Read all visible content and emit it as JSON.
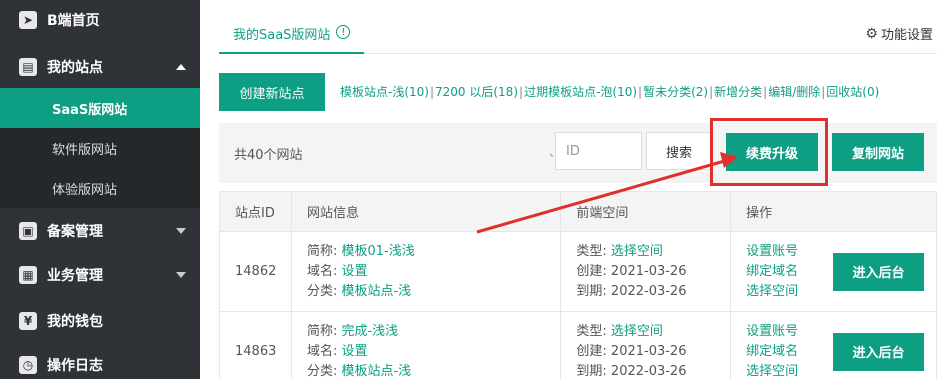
{
  "sidebar": {
    "items": [
      {
        "label": "B端首页",
        "icon": "paper-plane-icon",
        "glyph": "➤"
      },
      {
        "label": "我的站点",
        "icon": "document-icon",
        "glyph": "▤"
      }
    ],
    "subitems": [
      {
        "label": "SaaS版网站"
      },
      {
        "label": "软件版网站"
      },
      {
        "label": "体验版网站"
      }
    ],
    "more": [
      {
        "label": "备案管理",
        "icon": "gift-icon",
        "glyph": "▣"
      },
      {
        "label": "业务管理",
        "icon": "grid-icon",
        "glyph": "▦"
      },
      {
        "label": "我的钱包",
        "icon": "yen-icon",
        "glyph": "¥"
      },
      {
        "label": "操作日志",
        "icon": "clock-icon",
        "glyph": "◷"
      }
    ]
  },
  "tabs": {
    "active": "我的SaaS版网站",
    "info_glyph": "!",
    "settings_label": "功能设置",
    "settings_glyph": "⚙"
  },
  "toolbar": {
    "create_label": "创建新站点",
    "categories": [
      "模板站点-浅(10)",
      "7200 以后(18)",
      "过期模板站点-泡(10)",
      "暂未分类(2)",
      "新增分类",
      "编辑/删除",
      "回收站(0)"
    ],
    "separator": "|"
  },
  "filter": {
    "count_label": "共40个网站",
    "search_placeholder": "ID",
    "search_prefix": "、",
    "search_label": "搜索",
    "renew_label": "续费升级",
    "copy_label": "复制网站"
  },
  "table": {
    "headers": [
      "站点ID",
      "网站信息",
      "前端空间",
      "操作"
    ],
    "rows": [
      {
        "id": "14862",
        "info": [
          {
            "k": "简称: ",
            "v": "模板01-浅浅"
          },
          {
            "k": "域名: ",
            "v": "设置"
          },
          {
            "k": "分类: ",
            "v": "模板站点-浅"
          }
        ],
        "space": [
          {
            "k": "类型: ",
            "v": "选择空间",
            "link": true
          },
          {
            "k": "创建: ",
            "v": "2021-03-26",
            "link": false
          },
          {
            "k": "到期: ",
            "v": "2022-03-26",
            "link": false
          }
        ],
        "ops": [
          "设置账号",
          "绑定域名",
          "选择空间"
        ],
        "enter_label": "进入后台"
      },
      {
        "id": "14863",
        "info": [
          {
            "k": "简称: ",
            "v": "完成-浅浅"
          },
          {
            "k": "域名: ",
            "v": "设置"
          },
          {
            "k": "分类: ",
            "v": "模板站点-浅"
          }
        ],
        "space": [
          {
            "k": "类型: ",
            "v": "选择空间",
            "link": true
          },
          {
            "k": "创建: ",
            "v": "2021-03-26",
            "link": false
          },
          {
            "k": "到期: ",
            "v": "2022-03-26",
            "link": false
          }
        ],
        "ops": [
          "设置账号",
          "绑定域名",
          "选择空间"
        ],
        "enter_label": "进入后台"
      }
    ]
  },
  "colors": {
    "accent": "#0e9e84",
    "sidebar": "#2f3337",
    "annotation": "#e0302e"
  }
}
